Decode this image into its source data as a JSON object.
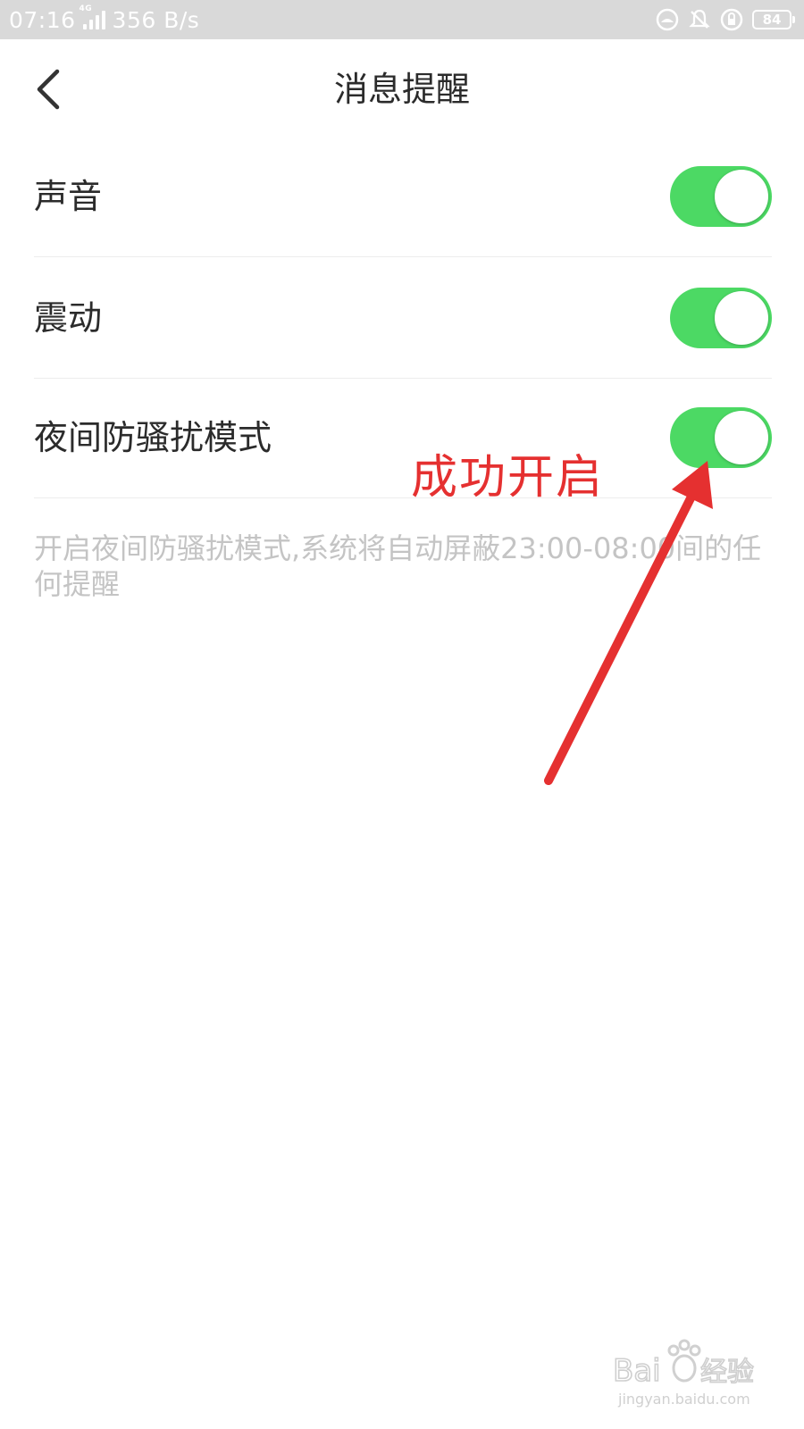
{
  "status_bar": {
    "time": "07:16",
    "network_type": "4G",
    "speed": "356 B/s",
    "battery": "84"
  },
  "header": {
    "title": "消息提醒"
  },
  "settings": [
    {
      "label": "声音",
      "enabled": true
    },
    {
      "label": "震动",
      "enabled": true
    },
    {
      "label": "夜间防骚扰模式",
      "enabled": true
    }
  ],
  "description": "开启夜间防骚扰模式,系统将自动屏蔽23:00-08:00间的任何提醒",
  "annotation": {
    "text": "成功开启"
  },
  "colors": {
    "toggle_on": "#4cd964",
    "annotation": "#e53030",
    "status_bar": "#d9d9d9"
  },
  "watermark": {
    "brand": "Baidu经验",
    "url": "jingyan.baidu.com"
  }
}
